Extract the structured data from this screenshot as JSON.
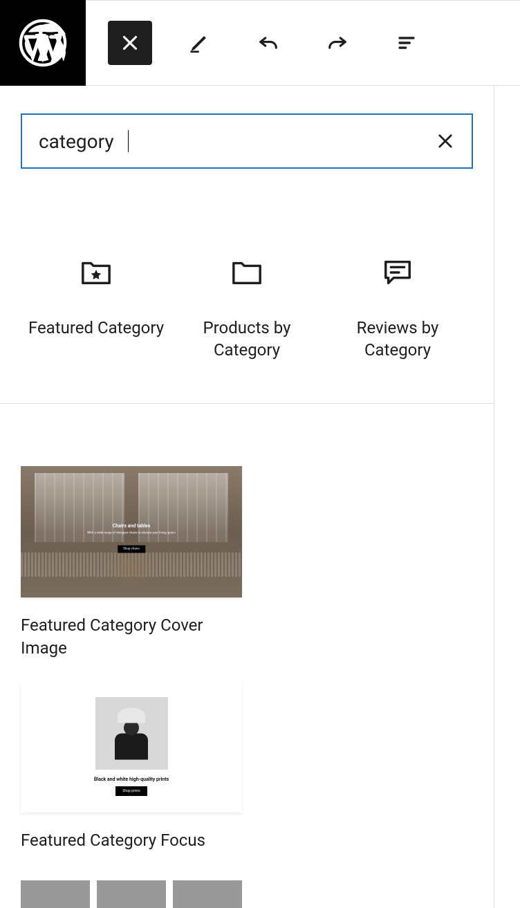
{
  "search": {
    "value": "category",
    "placeholder": ""
  },
  "blocks": [
    {
      "label": "Featured Category",
      "icon": "folder-star-icon"
    },
    {
      "label": "Products by Category",
      "icon": "folder-icon"
    },
    {
      "label": "Reviews by Category",
      "icon": "review-icon"
    }
  ],
  "patterns": [
    {
      "label": "Featured Category Cover Image",
      "preview": {
        "title": "Chairs and tables",
        "subtitle": "With a wide range of designer chairs to elevate your living space",
        "button": "Shop chairs"
      }
    },
    {
      "label": "Featured Category Focus",
      "preview": {
        "title": "Black and white high-quality prints",
        "button": "Shop prints"
      }
    }
  ]
}
